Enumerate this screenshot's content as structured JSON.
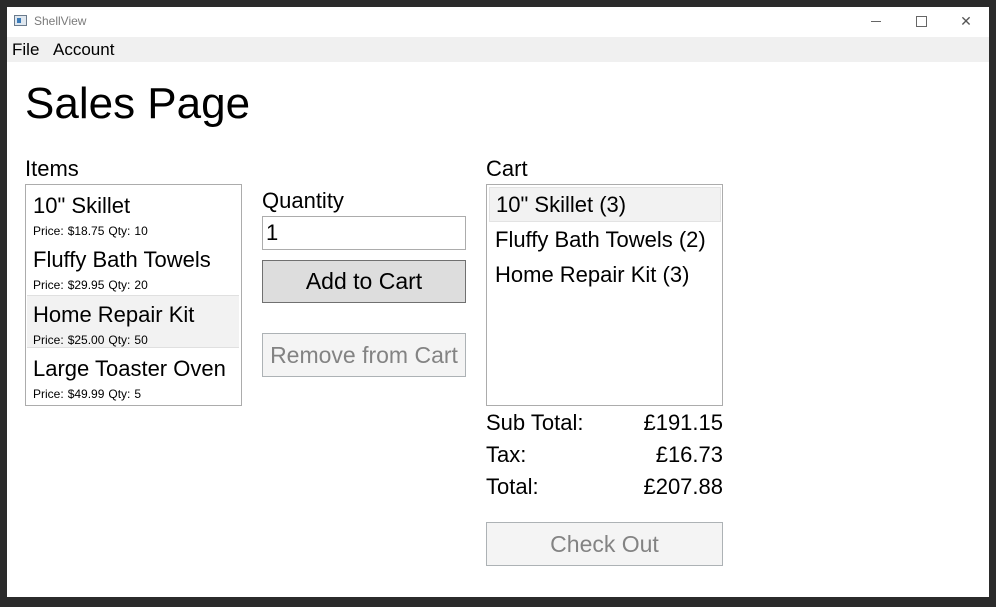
{
  "window": {
    "title": "ShellView"
  },
  "menu": {
    "file": "File",
    "account": "Account"
  },
  "page": {
    "title": "Sales Page"
  },
  "items": {
    "label": "Items",
    "list": [
      {
        "name": "10\" Skillet",
        "price_label": "Price:",
        "price": "$18.75",
        "qty_label": "Qty:",
        "qty": "10"
      },
      {
        "name": "Fluffy Bath Towels",
        "price_label": "Price:",
        "price": "$29.95",
        "qty_label": "Qty:",
        "qty": "20"
      },
      {
        "name": "Home Repair Kit",
        "price_label": "Price:",
        "price": "$25.00",
        "qty_label": "Qty:",
        "qty": "50"
      },
      {
        "name": "Large Toaster Oven",
        "price_label": "Price:",
        "price": "$49.99",
        "qty_label": "Qty:",
        "qty": "5"
      }
    ],
    "selected_index": 2
  },
  "quantity": {
    "label": "Quantity",
    "value": "1"
  },
  "buttons": {
    "add_to_cart": "Add to Cart",
    "remove_from_cart": "Remove from Cart",
    "check_out": "Check Out"
  },
  "cart": {
    "label": "Cart",
    "list": [
      "10\" Skillet (3)",
      "Fluffy Bath Towels (2)",
      "Home Repair Kit (3)"
    ],
    "selected_index": 0
  },
  "totals": {
    "subtotal_label": "Sub Total:",
    "subtotal": "£191.15",
    "tax_label": "Tax:",
    "tax": "£16.73",
    "total_label": "Total:",
    "total": "£207.88"
  }
}
